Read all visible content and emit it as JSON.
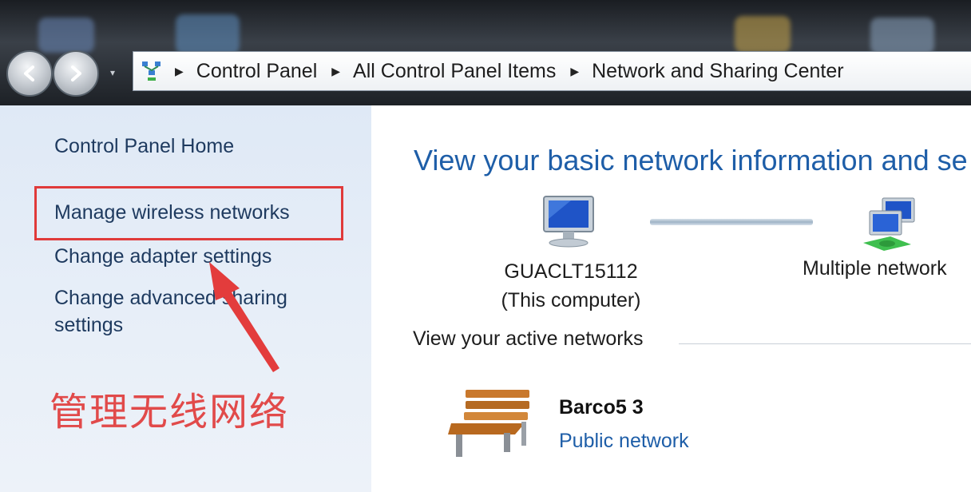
{
  "breadcrumb": {
    "items": [
      "Control Panel",
      "All Control Panel Items",
      "Network and Sharing Center"
    ]
  },
  "sidebar": {
    "home": "Control Panel Home",
    "manage_wireless": "Manage wireless networks",
    "adapter": "Change adapter settings",
    "advanced": "Change advanced sharing settings"
  },
  "annotation": {
    "text": "管理无线网络",
    "color": "#e14a4a"
  },
  "main": {
    "heading": "View your basic network information and se",
    "computer_name": "GUACLT15112",
    "computer_note": "(This computer)",
    "multiple_networks": "Multiple network",
    "active_section": "View your active networks",
    "active_network": {
      "name": "Barco5  3",
      "type": "Public network"
    }
  },
  "icons": [
    "back-arrow-icon",
    "forward-arrow-icon",
    "network-center-icon",
    "computer-icon",
    "multiple-networks-icon",
    "park-bench-icon"
  ],
  "colors": {
    "link_blue": "#1e5ea8",
    "sidebar_text": "#1e3a5f",
    "highlight_red": "#e03a3a"
  }
}
